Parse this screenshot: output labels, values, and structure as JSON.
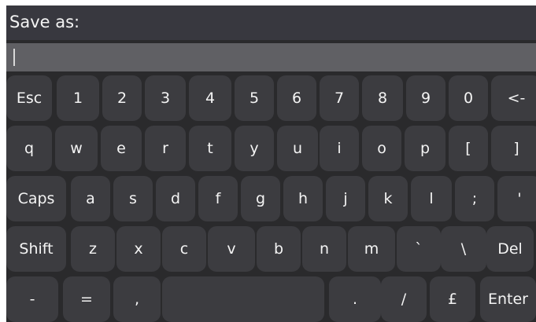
{
  "prompt": {
    "label": "Save as:",
    "value": ""
  },
  "keyboard": {
    "rows": [
      [
        {
          "label": "Esc",
          "name": "esc-key"
        },
        {
          "label": "1",
          "name": "key-1"
        },
        {
          "label": "2",
          "name": "key-2"
        },
        {
          "label": "3",
          "name": "key-3"
        },
        {
          "label": "4",
          "name": "key-4"
        },
        {
          "label": "5",
          "name": "key-5"
        },
        {
          "label": "6",
          "name": "key-6"
        },
        {
          "label": "7",
          "name": "key-7"
        },
        {
          "label": "8",
          "name": "key-8"
        },
        {
          "label": "9",
          "name": "key-9"
        },
        {
          "label": "0",
          "name": "key-0"
        },
        {
          "label": "<-",
          "name": "backspace-key"
        }
      ],
      [
        {
          "label": "q",
          "name": "key-q"
        },
        {
          "label": "w",
          "name": "key-w"
        },
        {
          "label": "e",
          "name": "key-e"
        },
        {
          "label": "r",
          "name": "key-r"
        },
        {
          "label": "t",
          "name": "key-t"
        },
        {
          "label": "y",
          "name": "key-y"
        },
        {
          "label": "u",
          "name": "key-u"
        },
        {
          "label": "i",
          "name": "key-i"
        },
        {
          "label": "o",
          "name": "key-o"
        },
        {
          "label": "p",
          "name": "key-p"
        },
        {
          "label": "[",
          "name": "key-left-bracket"
        },
        {
          "label": "]",
          "name": "key-right-bracket"
        }
      ],
      [
        {
          "label": "Caps",
          "name": "caps-lock-key"
        },
        {
          "label": "a",
          "name": "key-a"
        },
        {
          "label": "s",
          "name": "key-s"
        },
        {
          "label": "d",
          "name": "key-d"
        },
        {
          "label": "f",
          "name": "key-f"
        },
        {
          "label": "g",
          "name": "key-g"
        },
        {
          "label": "h",
          "name": "key-h"
        },
        {
          "label": "j",
          "name": "key-j"
        },
        {
          "label": "k",
          "name": "key-k"
        },
        {
          "label": "l",
          "name": "key-l"
        },
        {
          "label": ";",
          "name": "key-semicolon"
        },
        {
          "label": "'",
          "name": "key-apostrophe"
        }
      ],
      [
        {
          "label": "Shift",
          "name": "shift-key"
        },
        {
          "label": "z",
          "name": "key-z"
        },
        {
          "label": "x",
          "name": "key-x"
        },
        {
          "label": "c",
          "name": "key-c"
        },
        {
          "label": "v",
          "name": "key-v"
        },
        {
          "label": "b",
          "name": "key-b"
        },
        {
          "label": "n",
          "name": "key-n"
        },
        {
          "label": "m",
          "name": "key-m"
        },
        {
          "label": "`",
          "name": "key-backtick"
        },
        {
          "label": "\\",
          "name": "key-backslash"
        },
        {
          "label": "Del",
          "name": "delete-key"
        }
      ],
      [
        {
          "label": "-",
          "name": "key-minus"
        },
        {
          "label": "=",
          "name": "key-equals"
        },
        {
          "label": ",",
          "name": "key-comma"
        },
        {
          "label": "",
          "name": "space-key"
        },
        {
          "label": ".",
          "name": "key-period"
        },
        {
          "label": "/",
          "name": "key-slash"
        },
        {
          "label": "£",
          "name": "key-pound"
        },
        {
          "label": "Enter",
          "name": "enter-key"
        }
      ]
    ]
  }
}
